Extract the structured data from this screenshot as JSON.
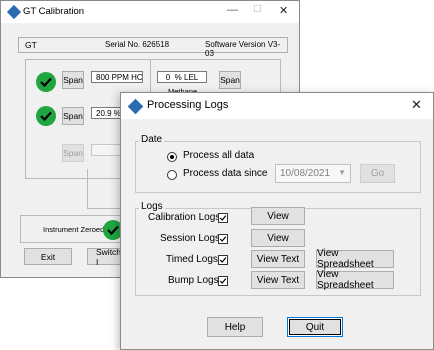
{
  "back": {
    "title": "GT Calibration",
    "controls": {
      "minimize": "—",
      "maximize": "☐",
      "close": "✕"
    },
    "header": {
      "model": "GT",
      "serial": "Serial No. 626518",
      "version": "Software Version V3-03"
    },
    "rows": [
      {
        "span": "Span",
        "field": "800 PPM HC",
        "value": "0",
        "unit": "% LEL",
        "gas": "Methane",
        "span2": "Span"
      },
      {
        "span": "Span",
        "field": "20.9 %"
      },
      {
        "span": "Span",
        "field": ""
      }
    ],
    "zeroed": "Instrument Zeroed",
    "exit": "Exit",
    "switch": "Switch I"
  },
  "front": {
    "title": "Processing Logs",
    "close": "✕",
    "date_group": "Date",
    "radio_all": "Process all data",
    "radio_since": "Process data since",
    "date_value": "10/08/2021",
    "go": "Go",
    "logs_group": "Logs",
    "rows": [
      {
        "label": "Calibration Logs",
        "btn1": "View",
        "btn2": ""
      },
      {
        "label": "Session Logs",
        "btn1": "View",
        "btn2": ""
      },
      {
        "label": "Timed Logs",
        "btn1": "View Text",
        "btn2": "View Spreadsheet"
      },
      {
        "label": "Bump Logs",
        "btn1": "View Text",
        "btn2": "View Spreadsheet"
      }
    ],
    "help": "Help",
    "quit": "Quit"
  }
}
